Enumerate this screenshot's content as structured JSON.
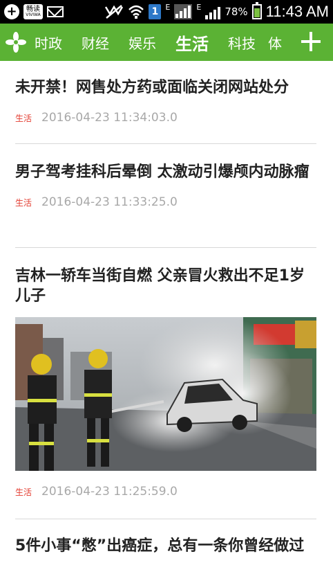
{
  "status_bar": {
    "app_label": "畅读",
    "app_sublabel": "VIVIWA",
    "sim_slot": "1",
    "network_type_1": "E",
    "network_type_2": "E",
    "battery": "78%",
    "time": "11:43 AM",
    "icons": [
      "add-icon",
      "app-icon",
      "mail-icon",
      "mute-icon",
      "wifi-icon",
      "sim-icon",
      "signal-icon",
      "battery-icon"
    ]
  },
  "nav": {
    "logo_icon": "pinwheel-icon",
    "tabs": [
      {
        "label": "时政"
      },
      {
        "label": "财经"
      },
      {
        "label": "娱乐"
      },
      {
        "label": "生活",
        "active": true
      },
      {
        "label": "科技"
      },
      {
        "label": "体"
      }
    ],
    "add_icon": "plus-icon",
    "bg_color": "#5bb234"
  },
  "feed": {
    "articles": [
      {
        "title": "未开禁！网售处方药或面临关闭网站处分",
        "category": "生活",
        "time": "2016-04-23 11:34:03.0"
      },
      {
        "title": "男子驾考挂科后晕倒 太激动引爆颅内动脉瘤",
        "category": "生活",
        "time": "2016-04-23 11:33:25.0"
      },
      {
        "title": "吉林一轿车当街自燃 父亲冒火救出不足1岁儿子",
        "category": "生活",
        "time": "2016-04-23 11:25:59.0",
        "image": "firefighters-burning-car-photo"
      },
      {
        "title": "5件小事“憋”出癌症，总有一条你曾经做过"
      }
    ]
  },
  "colors": {
    "category": "#e33b2f",
    "timestamp": "#a8a8a8",
    "title": "#222222"
  }
}
